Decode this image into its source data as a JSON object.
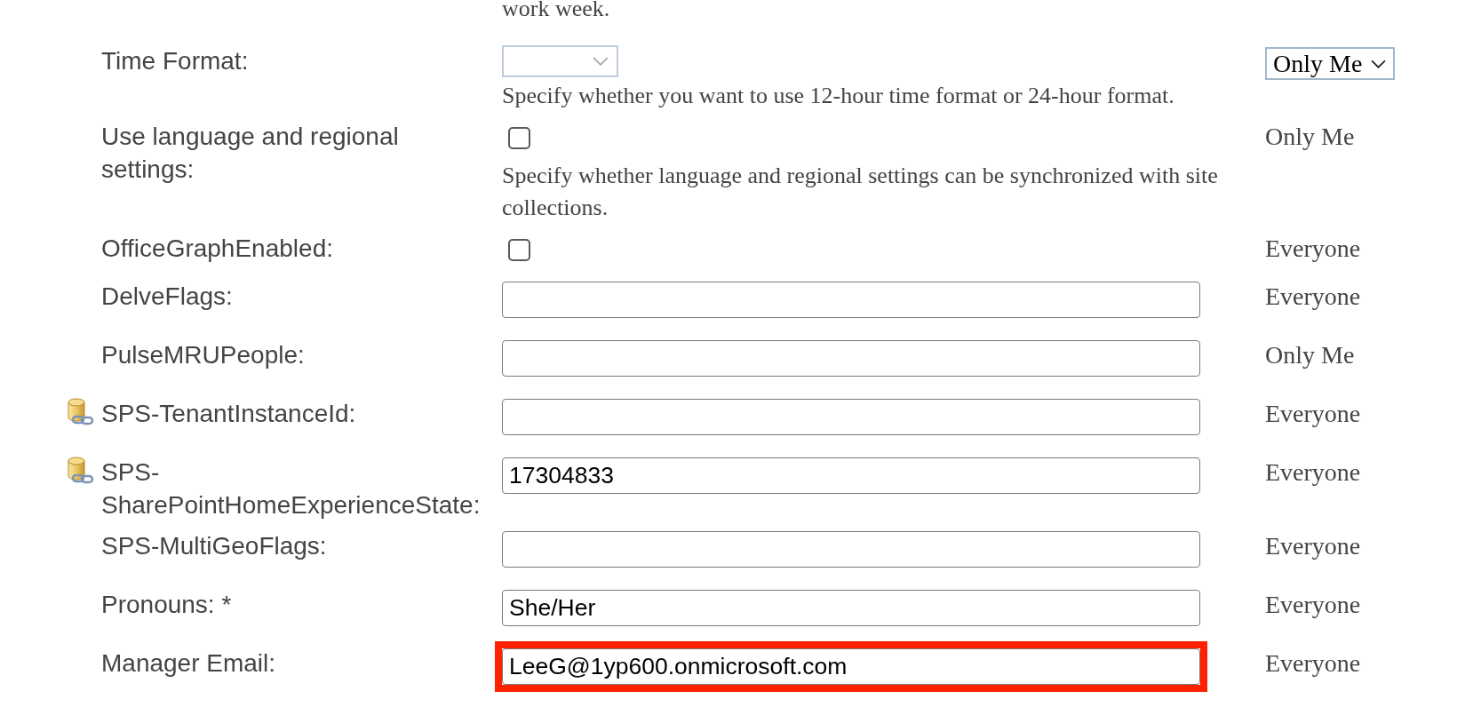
{
  "cut_off_description": "work week.",
  "rows": [
    {
      "kind": "select",
      "linked": false,
      "label": "Time Format:",
      "highlighted": false,
      "description": "Specify whether you want to use 12-hour time format or 24-hour format.",
      "privacy": {
        "kind": "select",
        "value": "Only Me"
      }
    },
    {
      "kind": "checkbox",
      "linked": false,
      "label": "Use language and regional settings:",
      "checked": false,
      "highlighted": false,
      "description": "Specify whether language and regional settings can be synchronized with site collections.",
      "privacy": {
        "kind": "text",
        "value": "Only Me"
      }
    },
    {
      "kind": "checkbox",
      "linked": false,
      "label": "OfficeGraphEnabled:",
      "checked": false,
      "highlighted": false,
      "privacy": {
        "kind": "text",
        "value": "Everyone"
      }
    },
    {
      "kind": "text",
      "linked": false,
      "label": "DelveFlags:",
      "highlighted": false,
      "privacy": {
        "kind": "text",
        "value": "Everyone"
      }
    },
    {
      "kind": "text",
      "linked": false,
      "label": "PulseMRUPeople:",
      "highlighted": false,
      "privacy": {
        "kind": "text",
        "value": "Only Me"
      }
    },
    {
      "kind": "text",
      "linked": true,
      "label": "SPS-TenantInstanceId:",
      "highlighted": false,
      "privacy": {
        "kind": "text",
        "value": "Everyone"
      }
    },
    {
      "kind": "text",
      "linked": true,
      "label": "SPS-SharePointHomeExperienceState:",
      "value": "17304833",
      "highlighted": false,
      "privacy": {
        "kind": "text",
        "value": "Everyone"
      }
    },
    {
      "kind": "text",
      "linked": false,
      "label": "SPS-MultiGeoFlags:",
      "highlighted": false,
      "privacy": {
        "kind": "text",
        "value": "Everyone"
      }
    },
    {
      "kind": "text",
      "linked": false,
      "label": "Pronouns: *",
      "value": "She/Her",
      "highlighted": false,
      "privacy": {
        "kind": "text",
        "value": "Everyone"
      }
    },
    {
      "kind": "text",
      "linked": false,
      "label": "Manager Email:",
      "value": "LeeG@1yp600.onmicrosoft.com",
      "highlighted": true,
      "privacy": {
        "kind": "text",
        "value": "Everyone"
      }
    }
  ]
}
